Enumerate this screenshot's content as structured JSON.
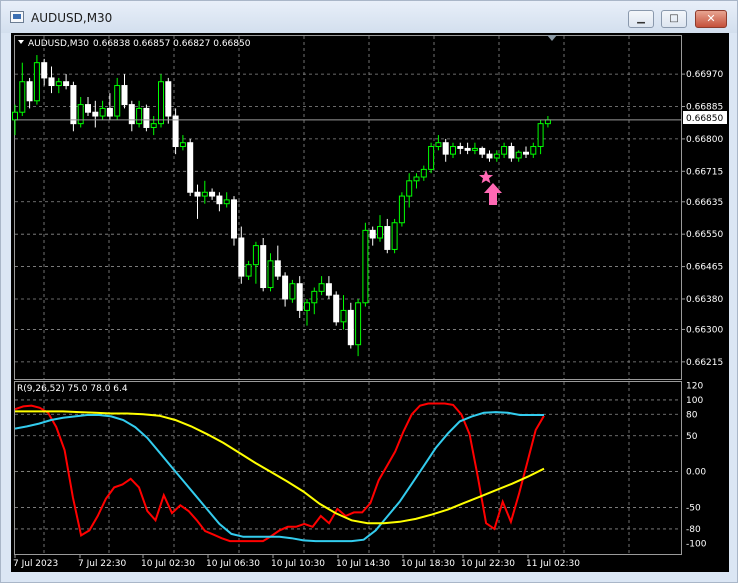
{
  "window": {
    "title": "AUDUSD,M30",
    "minimize_symbol": "▁",
    "maximize_symbol": "□",
    "close_symbol": "✕"
  },
  "chart_header": {
    "symbol_tf": "AUDUSD,M30",
    "ohlc": "0.66838 0.66857 0.66827 0.66850"
  },
  "indicator_header": "R(9,26,52) 75.0 78.0 6.4",
  "price_axis": [
    "0.66970",
    "0.66885",
    "0.66800",
    "0.66715",
    "0.66635",
    "0.66550",
    "0.66465",
    "0.66380",
    "0.66300",
    "0.66215"
  ],
  "current_price": "0.66850",
  "indicator_axis": [
    "120",
    "100",
    "80",
    "50",
    "0.00",
    "-50",
    "-80",
    "-100"
  ],
  "time_axis": [
    "7 Jul 2023",
    "7 Jul 22:30",
    "10 Jul 02:30",
    "10 Jul 06:30",
    "10 Jul 10:30",
    "10 Jul 14:30",
    "10 Jul 18:30",
    "10 Jul 22:30",
    "11 Jul 02:30"
  ],
  "colors": {
    "bull": "#00ff00",
    "bear": "#ffffff",
    "grid": "#8c8c8c",
    "red_line": "#ff0000",
    "cyan_line": "#33ccee",
    "yellow_line": "#ffff00",
    "arrow": "#ff69b4"
  },
  "icons": {
    "arrow": "up-arrow-icon",
    "star": "star-icon"
  },
  "chart_data": {
    "type": "line",
    "title": "AUDUSD,M30",
    "candles": [
      [
        0.6685,
        0.6689,
        0.6681,
        0.6687
      ],
      [
        0.6687,
        0.67,
        0.6686,
        0.6695
      ],
      [
        0.6695,
        0.6696,
        0.6688,
        0.669
      ],
      [
        0.669,
        0.6702,
        0.6689,
        0.67
      ],
      [
        0.67,
        0.6701,
        0.6694,
        0.6696
      ],
      [
        0.6696,
        0.6699,
        0.6692,
        0.6694
      ],
      [
        0.6694,
        0.6696,
        0.6692,
        0.6695
      ],
      [
        0.6695,
        0.6697,
        0.6693,
        0.6694
      ],
      [
        0.6694,
        0.6695,
        0.6682,
        0.6684
      ],
      [
        0.6684,
        0.6691,
        0.6683,
        0.6689
      ],
      [
        0.6689,
        0.6691,
        0.6686,
        0.6687
      ],
      [
        0.6687,
        0.669,
        0.6683,
        0.6686
      ],
      [
        0.6686,
        0.669,
        0.6685,
        0.6688
      ],
      [
        0.6688,
        0.6692,
        0.6685,
        0.6686
      ],
      [
        0.6686,
        0.6696,
        0.6685,
        0.6694
      ],
      [
        0.6694,
        0.6697,
        0.6688,
        0.6689
      ],
      [
        0.6689,
        0.669,
        0.6682,
        0.6684
      ],
      [
        0.6684,
        0.669,
        0.6683,
        0.6688
      ],
      [
        0.6688,
        0.6689,
        0.6682,
        0.6683
      ],
      [
        0.6683,
        0.6686,
        0.6681,
        0.6684
      ],
      [
        0.6684,
        0.6697,
        0.6683,
        0.6695
      ],
      [
        0.6695,
        0.6696,
        0.6684,
        0.6686
      ],
      [
        0.6686,
        0.6688,
        0.6676,
        0.6678
      ],
      [
        0.6678,
        0.6681,
        0.6677,
        0.6679
      ],
      [
        0.6679,
        0.668,
        0.6665,
        0.6666
      ],
      [
        0.6666,
        0.6668,
        0.6659,
        0.6665
      ],
      [
        0.6665,
        0.6669,
        0.6663,
        0.6666
      ],
      [
        0.6666,
        0.6667,
        0.6664,
        0.6665
      ],
      [
        0.6665,
        0.6666,
        0.6661,
        0.6663
      ],
      [
        0.6663,
        0.6666,
        0.6662,
        0.6664
      ],
      [
        0.6664,
        0.6665,
        0.6652,
        0.6654
      ],
      [
        0.6654,
        0.6657,
        0.6642,
        0.6644
      ],
      [
        0.6644,
        0.6648,
        0.6643,
        0.6647
      ],
      [
        0.6647,
        0.6653,
        0.6642,
        0.6652
      ],
      [
        0.6652,
        0.6654,
        0.664,
        0.6641
      ],
      [
        0.6641,
        0.665,
        0.664,
        0.6648
      ],
      [
        0.6648,
        0.6652,
        0.6643,
        0.6644
      ],
      [
        0.6644,
        0.6645,
        0.6636,
        0.6638
      ],
      [
        0.6638,
        0.6643,
        0.6637,
        0.6642
      ],
      [
        0.6642,
        0.6644,
        0.6633,
        0.6635
      ],
      [
        0.6635,
        0.6638,
        0.6631,
        0.6637
      ],
      [
        0.6637,
        0.6641,
        0.6634,
        0.664
      ],
      [
        0.664,
        0.6644,
        0.6639,
        0.6642
      ],
      [
        0.6642,
        0.6644,
        0.6638,
        0.6639
      ],
      [
        0.6639,
        0.664,
        0.6631,
        0.6632
      ],
      [
        0.6632,
        0.6639,
        0.663,
        0.6635
      ],
      [
        0.6635,
        0.6637,
        0.6625,
        0.6626
      ],
      [
        0.6626,
        0.6638,
        0.6623,
        0.6637
      ],
      [
        0.6637,
        0.6658,
        0.6636,
        0.6656
      ],
      [
        0.6656,
        0.6657,
        0.6652,
        0.6654
      ],
      [
        0.6654,
        0.666,
        0.6653,
        0.6657
      ],
      [
        0.6657,
        0.6659,
        0.665,
        0.6651
      ],
      [
        0.6651,
        0.6659,
        0.665,
        0.6658
      ],
      [
        0.6658,
        0.6666,
        0.6657,
        0.6665
      ],
      [
        0.6665,
        0.6671,
        0.6662,
        0.6669
      ],
      [
        0.6669,
        0.6671,
        0.6667,
        0.667
      ],
      [
        0.667,
        0.6673,
        0.6669,
        0.6672
      ],
      [
        0.6672,
        0.6679,
        0.6671,
        0.6678
      ],
      [
        0.6678,
        0.6681,
        0.6677,
        0.6679
      ],
      [
        0.6679,
        0.668,
        0.6674,
        0.6676
      ],
      [
        0.6676,
        0.6679,
        0.6675,
        0.6678
      ],
      [
        0.6678,
        0.6679,
        0.6676,
        0.66775
      ],
      [
        0.66775,
        0.6679,
        0.6676,
        0.6677
      ],
      [
        0.6677,
        0.6679,
        0.6676,
        0.66775
      ],
      [
        0.66775,
        0.6678,
        0.6675,
        0.6676
      ],
      [
        0.6676,
        0.6677,
        0.6674,
        0.6675
      ],
      [
        0.6675,
        0.6677,
        0.6674,
        0.6676
      ],
      [
        0.6676,
        0.6679,
        0.6675,
        0.6678
      ],
      [
        0.6678,
        0.6679,
        0.6674,
        0.6675
      ],
      [
        0.6675,
        0.6677,
        0.6674,
        0.66765
      ],
      [
        0.66765,
        0.6678,
        0.6675,
        0.6676
      ],
      [
        0.6676,
        0.6679,
        0.6675,
        0.6678
      ],
      [
        0.6678,
        0.6685,
        0.6676,
        0.6684
      ],
      [
        0.6684,
        0.6686,
        0.6683,
        0.6685
      ]
    ],
    "candle_time_step_minutes": 30,
    "price_range": [
      0.6617,
      0.6707
    ],
    "indicator_range": [
      -115,
      125
    ],
    "series": [
      {
        "values": [
          87,
          91,
          92,
          89,
          82,
          62,
          30,
          -36,
          -89,
          -82,
          -62,
          -38,
          -22,
          -18,
          -10,
          -22,
          -55,
          -68,
          -33,
          -58,
          -47,
          -55,
          -68,
          -83,
          -88,
          -93,
          -97,
          -97,
          -97,
          -97,
          -97,
          -90,
          -82,
          -77,
          -77,
          -73,
          -77,
          -62,
          -72,
          -52,
          -62,
          -57,
          -57,
          -44,
          -12,
          8,
          28,
          56,
          80,
          92,
          95,
          95,
          95,
          93,
          80,
          52,
          -8,
          -72,
          -80,
          -42,
          -70,
          -30,
          14,
          58,
          78
        ]
      },
      {
        "values": [
          60,
          63,
          67,
          72,
          75,
          77,
          79,
          79,
          77,
          72,
          62,
          47,
          27,
          7,
          -13,
          -33,
          -53,
          -73,
          -87,
          -91,
          -91,
          -91,
          -91,
          -93,
          -96,
          -97,
          -97,
          -97,
          -97,
          -95,
          -82,
          -62,
          -42,
          -17,
          8,
          33,
          53,
          70,
          77,
          82,
          83,
          82,
          79,
          79,
          79
        ]
      },
      {
        "values": [
          84,
          84,
          84,
          84,
          83,
          82,
          81,
          81,
          80,
          78,
          72,
          63,
          52,
          40,
          26,
          12,
          -1,
          -14,
          -28,
          -45,
          -58,
          -68,
          -72,
          -72,
          -70,
          -66,
          -60,
          -53,
          -44,
          -35,
          -26,
          -17,
          -7,
          4
        ]
      }
    ],
    "ylabel": "",
    "xlabel": ""
  }
}
